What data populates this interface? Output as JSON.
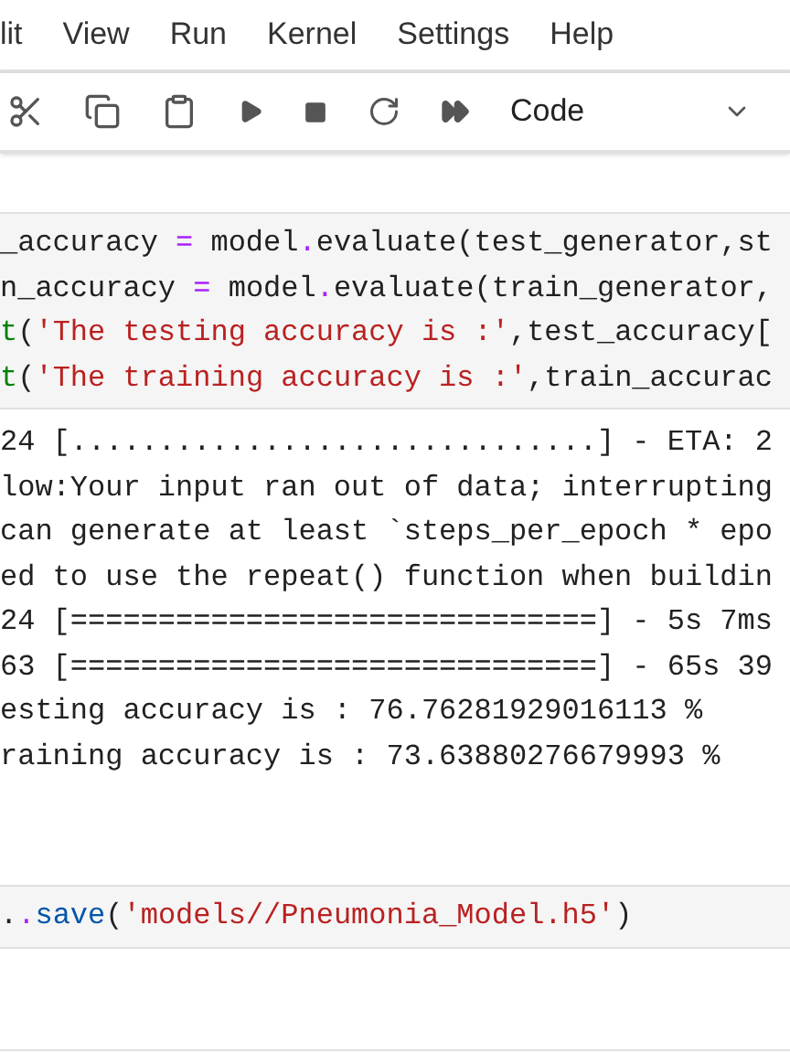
{
  "menu": [
    {
      "label": "lit"
    },
    {
      "label": "View"
    },
    {
      "label": "Run"
    },
    {
      "label": "Kernel"
    },
    {
      "label": "Settings"
    },
    {
      "label": "Help"
    }
  ],
  "toolbar": {
    "cell_type": "Code"
  },
  "cells": [
    {
      "code": [
        [
          {
            "kind": "plain",
            "text": "_accuracy "
          },
          {
            "kind": "op",
            "text": "="
          },
          {
            "kind": "plain",
            "text": " model"
          },
          {
            "kind": "op",
            "text": "."
          },
          {
            "kind": "plain",
            "text": "evaluate(test_generator,st"
          }
        ],
        [
          {
            "kind": "plain",
            "text": "n_accuracy "
          },
          {
            "kind": "op",
            "text": "="
          },
          {
            "kind": "plain",
            "text": " model"
          },
          {
            "kind": "op",
            "text": "."
          },
          {
            "kind": "plain",
            "text": "evaluate(train_generator,"
          }
        ],
        [
          {
            "kind": "builtin",
            "text": "t"
          },
          {
            "kind": "plain",
            "text": "("
          },
          {
            "kind": "string",
            "text": "'The testing accuracy is :'"
          },
          {
            "kind": "plain",
            "text": ",test_accuracy["
          }
        ],
        [
          {
            "kind": "builtin",
            "text": "t"
          },
          {
            "kind": "plain",
            "text": "("
          },
          {
            "kind": "string",
            "text": "'The training accuracy is :'"
          },
          {
            "kind": "plain",
            "text": ",train_accurac"
          }
        ]
      ],
      "output": [
        "24 [..............................] - ETA: 2",
        "low:Your input ran out of data; interrupting",
        "can generate at least `steps_per_epoch * epo",
        "ed to use the repeat() function when buildin",
        "24 [==============================] - 5s 7ms",
        "63 [==============================] - 65s 39",
        "esting accuracy is : 76.76281929016113 %",
        "raining accuracy is : 73.63880276679993 %"
      ]
    },
    {
      "code": [
        [
          {
            "kind": "plain",
            "text": "."
          },
          {
            "kind": "op",
            "text": "."
          },
          {
            "kind": "method",
            "text": "save"
          },
          {
            "kind": "plain",
            "text": "("
          },
          {
            "kind": "string",
            "text": "'models//Pneumonia_Model.h5'"
          },
          {
            "kind": "plain",
            "text": ")"
          }
        ]
      ]
    }
  ]
}
